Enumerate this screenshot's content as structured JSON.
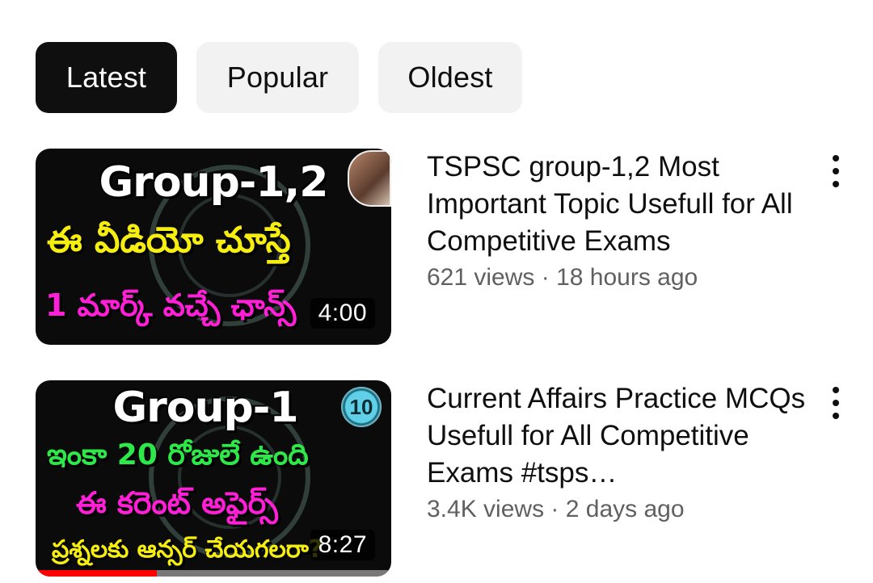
{
  "filters": {
    "chips": [
      {
        "label": "Latest",
        "active": true
      },
      {
        "label": "Popular",
        "active": false
      },
      {
        "label": "Oldest",
        "active": false
      }
    ]
  },
  "videos": [
    {
      "title": "TSPSC group-1,2 Most Important Topic Usefull for All Competitive Exams",
      "views": "621 views",
      "age": "18 hours ago",
      "duration": "4:00",
      "thumbnail": {
        "title": "Group-1,2",
        "line_a": "ఈ వీడియో చూస్తే",
        "line_b": "1 మార్క్ వచ్చే ఛాన్స్"
      },
      "progress_fraction": 0
    },
    {
      "title": "Current Affairs Practice MCQs Usefull for All Competitive Exams #tsps…",
      "views": "3.4K views",
      "age": "2 days ago",
      "duration": "8:27",
      "thumbnail": {
        "title": "Group-1",
        "badge": "10",
        "line_a": "ఇంకా 20 రోజులే ఉంది",
        "line_b": "ఈ కరెంట్ అఫైర్స్",
        "line_c": "ప్రశ్నలకు ఆన్సర్ చేయగలరా?"
      },
      "progress_fraction": 0.34
    }
  ],
  "colors": {
    "chip_active_bg": "#0f0f0f",
    "chip_bg": "#f2f2f2",
    "progress": "#ff0000",
    "meta_text": "#606060"
  },
  "icons": {
    "more": "more-vert-icon"
  }
}
